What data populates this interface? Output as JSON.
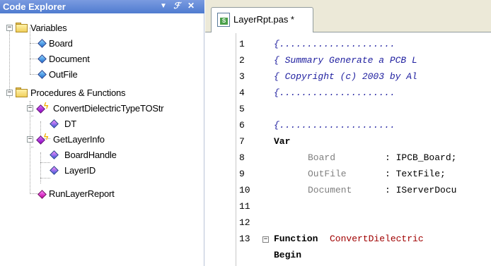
{
  "code_explorer": {
    "title": "Code Explorer",
    "buttons": {
      "dropdown_icon": "triangle-down",
      "pin_icon": "pin",
      "close_icon": "close-x"
    },
    "tree": {
      "variables_group": "Variables",
      "variables": [
        "Board",
        "Document",
        "OutFile"
      ],
      "procedures_group": "Procedures & Functions",
      "func1": "ConvertDielectricTypeTOStr",
      "func1_params": [
        "DT"
      ],
      "func2": "GetLayerInfo",
      "func2_params": [
        "BoardHandle",
        "LayerID"
      ],
      "proc1": "RunLayerReport",
      "toggle_collapse": "−"
    }
  },
  "editor": {
    "tab_label": "LayerRpt.pas *",
    "file_icon": "pascal-source-file",
    "line_numbers": [
      "1",
      "2",
      "3",
      "4",
      "5",
      "6",
      "7",
      "8",
      "9",
      "10",
      "11",
      "12",
      "13"
    ],
    "lines": {
      "l1": "{.....................",
      "l2": "{ Summary Generate a PCB L",
      "l3": "{ Copyright (c) 2003 by Al",
      "l4": "{.....................",
      "l6": "{.....................",
      "l7_kw": "Var",
      "l8_id": "Board    ",
      "l8_type": ": IPCB_Board;",
      "l9_id": "OutFile  ",
      "l9_type": ": TextFile;",
      "l10_id": "Document ",
      "l10_type": ": IServerDocu",
      "l12_kw": "Function",
      "l12_name": "ConvertDielectric",
      "l13_kw": "Begin"
    },
    "fold_toggle": "−"
  },
  "colors": {
    "header_blue": "#5a84d8",
    "comment_blue": "#2020a0",
    "function_red": "#a00000",
    "identifier_gray": "#808080"
  }
}
